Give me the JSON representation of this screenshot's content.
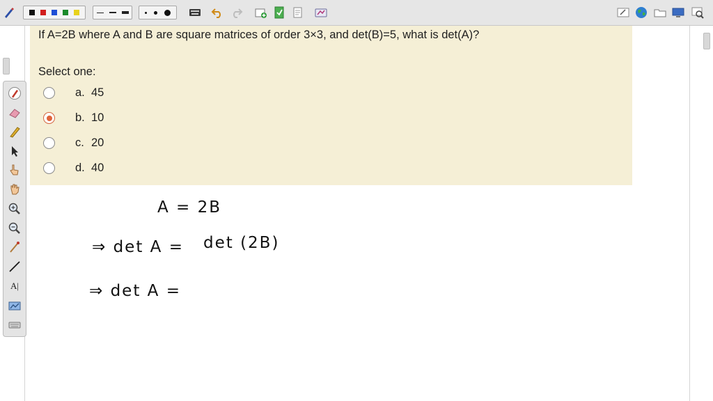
{
  "toolbar": {
    "colors": [
      "#111111",
      "#d11d1d",
      "#1f4fd6",
      "#1b8a2b",
      "#e8d21c"
    ],
    "icons": [
      "pen-settings-icon",
      "undo-icon",
      "redo-icon",
      "new-page-icon",
      "insert-page-icon",
      "page-icon",
      "screen-capture-icon",
      "whiteboard-icon",
      "globe-icon",
      "folder-icon",
      "display-icon",
      "magnifier-icon"
    ]
  },
  "palette": {
    "icons": [
      "pen-icon",
      "eraser-icon",
      "highlighter-icon",
      "pointer-icon",
      "hand-pointer-icon",
      "hand-icon",
      "zoom-in-icon",
      "zoom-out-icon",
      "line-tool-icon",
      "straight-line-icon",
      "text-tool-icon",
      "screen-capture-tool-icon",
      "keyboard-icon"
    ],
    "text_tool_label": "A|"
  },
  "question": {
    "text": "If A=2B where A and B are square matrices of order 3×3, and det(B)=5, what is det(A)?",
    "select_label": "Select one:",
    "options": [
      {
        "letter": "a.",
        "value": "45",
        "selected": false
      },
      {
        "letter": "b.",
        "value": "10",
        "selected": true
      },
      {
        "letter": "c.",
        "value": "20",
        "selected": false
      },
      {
        "letter": "d.",
        "value": "40",
        "selected": false
      }
    ],
    "accent_color": "#e0633a"
  },
  "handwriting": {
    "line1": "A = 2B",
    "line2_prefix": "⇒  det A =",
    "line2_rhs": "det (2B)",
    "line3_prefix": "⇒  det A ="
  }
}
